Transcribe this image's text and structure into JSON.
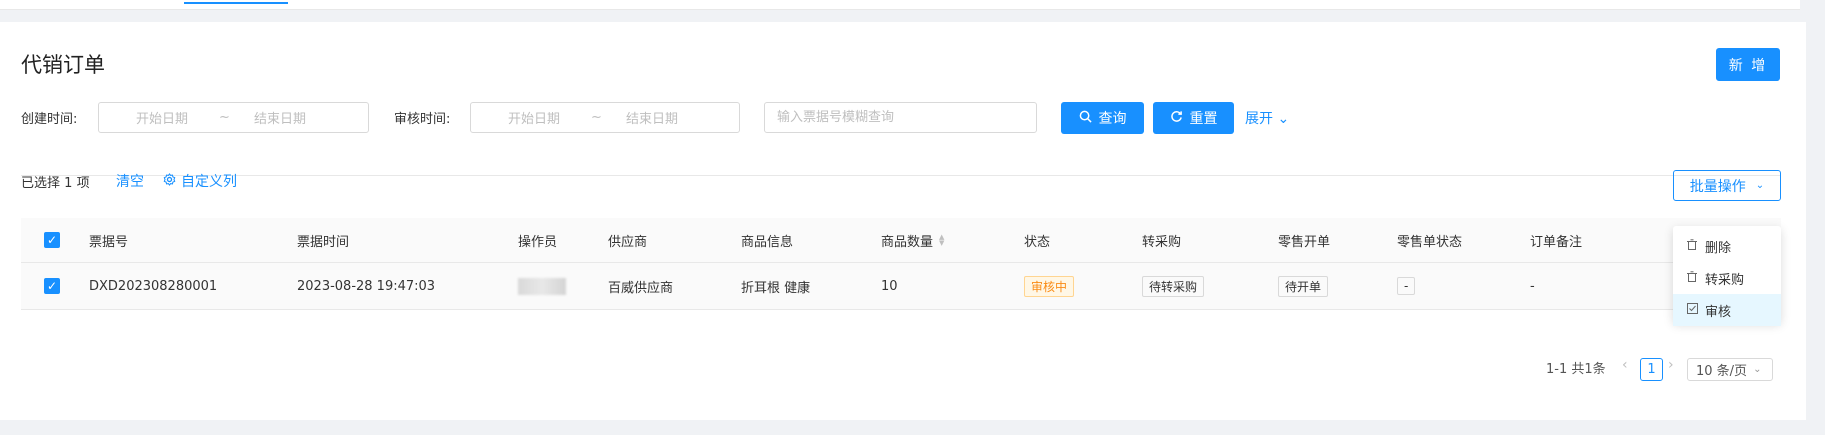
{
  "page": {
    "title": "代销订单",
    "new_button": "新 增"
  },
  "filters": {
    "create_time_label": "创建时间:",
    "audit_time_label": "审核时间:",
    "start_placeholder": "开始日期",
    "end_placeholder": "结束日期",
    "range_separator": "~",
    "search_placeholder": "输入票据号模糊查询",
    "query_button": "查询",
    "reset_button": "重置",
    "expand_link": "展开"
  },
  "toolbar": {
    "selected_prefix": "已选择",
    "selected_count": "1",
    "selected_suffix": "项",
    "clear_link": "清空",
    "custom_columns_link": "自定义列",
    "batch_button": "批量操作"
  },
  "table": {
    "columns": [
      "票据号",
      "票据时间",
      "操作员",
      "供应商",
      "商品信息",
      "商品数量",
      "状态",
      "转采购",
      "零售开单",
      "零售单状态",
      "订单备注"
    ],
    "rows": [
      {
        "bill_no": "DXD202308280001",
        "bill_time": "2023-08-28 19:47:03",
        "supplier": "百威供应商",
        "goods_info": "折耳根 健康",
        "quantity": "10",
        "status": "审核中",
        "transfer_purchase": "待转采购",
        "retail_order": "待开单",
        "retail_status": "-",
        "remark": "-"
      }
    ]
  },
  "dropdown": {
    "items": [
      {
        "label": "删除",
        "icon": "trash-icon"
      },
      {
        "label": "转采购",
        "icon": "trash-icon"
      },
      {
        "label": "审核",
        "icon": "check-square-icon"
      }
    ]
  },
  "pagination": {
    "total_text": "1-1 共1条",
    "current_page": "1",
    "page_size": "10 条/页"
  },
  "colors": {
    "primary": "#1890ff",
    "warning": "#fa8c16"
  }
}
